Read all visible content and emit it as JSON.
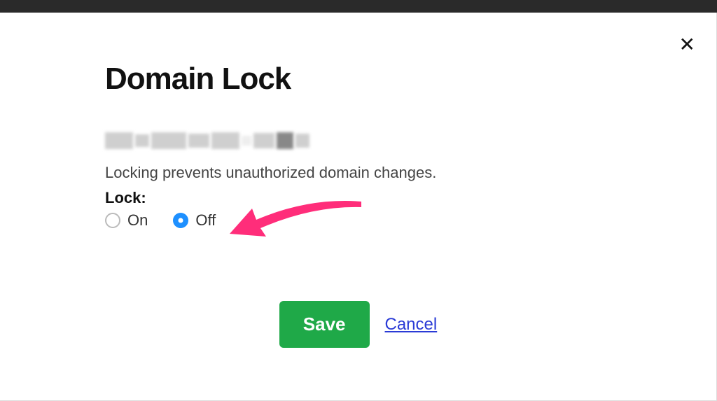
{
  "header": {
    "title": "Domain Lock",
    "close_symbol": "✕"
  },
  "body": {
    "description": "Locking prevents unauthorized domain changes.",
    "lock_label": "Lock:",
    "options": {
      "on": {
        "label": "On",
        "selected": false
      },
      "off": {
        "label": "Off",
        "selected": true
      }
    }
  },
  "actions": {
    "save_label": "Save",
    "cancel_label": "Cancel"
  }
}
